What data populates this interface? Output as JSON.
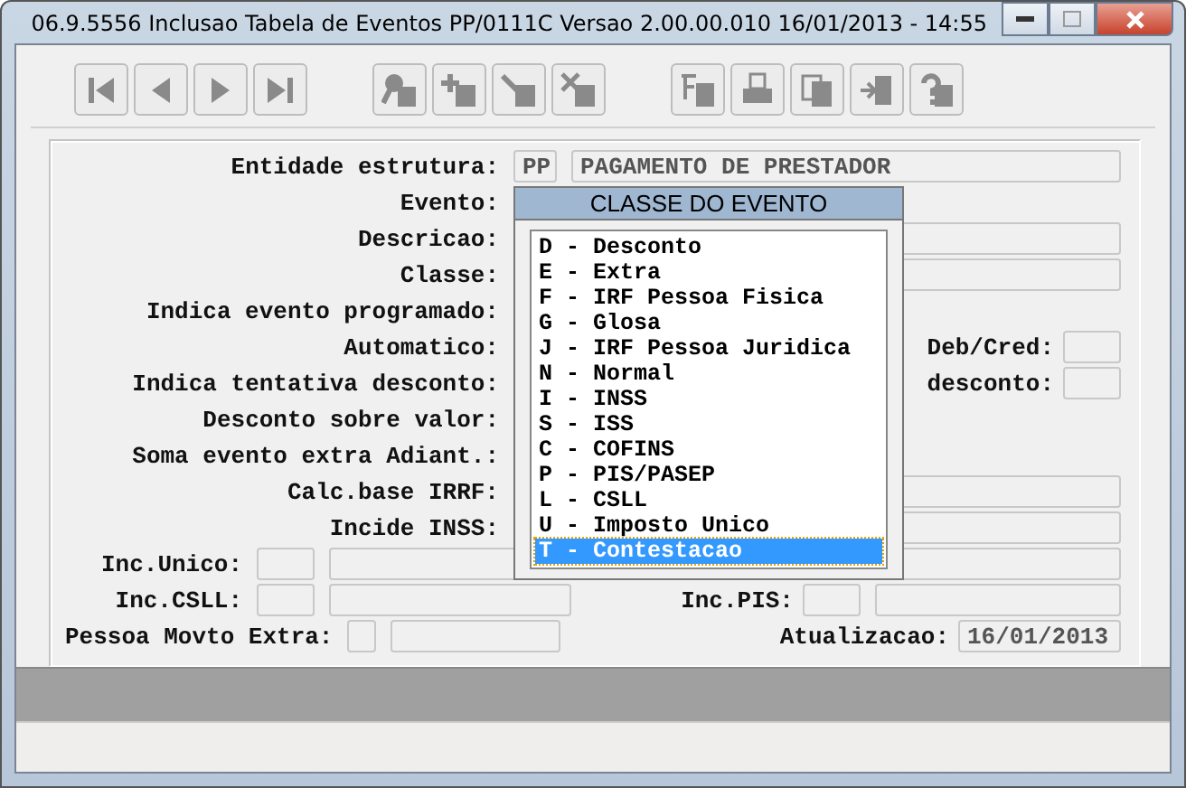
{
  "window": {
    "title": "06.9.5556  Inclusao  Tabela de Eventos PP/0111C Versao 2.00.00.010 16/01/2013 - 14:55"
  },
  "form": {
    "rows": [
      {
        "kind": "code_desc",
        "label": "Entidade estrutura:",
        "code": "PP",
        "description": "PAGAMENTO DE PRESTADOR"
      },
      {
        "kind": "blank",
        "label": "Evento:"
      },
      {
        "kind": "long",
        "label": "Descricao:"
      },
      {
        "kind": "long",
        "label": "Classe:"
      },
      {
        "kind": "blank",
        "label": "Indica evento programado:"
      },
      {
        "kind": "short_right",
        "label": "Automatico:",
        "right_label": "Deb/Cred:"
      },
      {
        "kind": "short_right",
        "label": "Indica tentativa desconto:",
        "right_label": "desconto:"
      },
      {
        "kind": "blank",
        "label": "Desconto sobre valor:"
      },
      {
        "kind": "blank",
        "label": "Soma evento extra Adiant.:"
      },
      {
        "kind": "long",
        "label": "Calc.base IRRF:"
      },
      {
        "kind": "long",
        "label": "Incide INSS:"
      }
    ],
    "bottom_rows": [
      {
        "kind": "pair_long",
        "label": "Inc.Unico:"
      },
      {
        "kind": "pair_pair",
        "label": "Inc.CSLL:",
        "right_label": "Inc.PIS:"
      },
      {
        "kind": "tiny_date",
        "label": "Pessoa Movto Extra:",
        "right_label": "Atualizacao:",
        "value": "16/01/2013"
      }
    ]
  },
  "popup": {
    "title": "CLASSE DO EVENTO",
    "items": [
      {
        "label": "D - Desconto",
        "selected": false
      },
      {
        "label": "E - Extra",
        "selected": false
      },
      {
        "label": "F - IRF Pessoa Fisica",
        "selected": false
      },
      {
        "label": "G - Glosa",
        "selected": false
      },
      {
        "label": "J - IRF Pessoa Juridica",
        "selected": false
      },
      {
        "label": "N - Normal",
        "selected": false
      },
      {
        "label": "I - INSS",
        "selected": false
      },
      {
        "label": "S - ISS",
        "selected": false
      },
      {
        "label": "C - COFINS",
        "selected": false
      },
      {
        "label": "P - PIS/PASEP",
        "selected": false
      },
      {
        "label": "L - CSLL",
        "selected": false
      },
      {
        "label": "U - Imposto Unico",
        "selected": false
      },
      {
        "label": "T - Contestacao",
        "selected": true
      }
    ]
  }
}
